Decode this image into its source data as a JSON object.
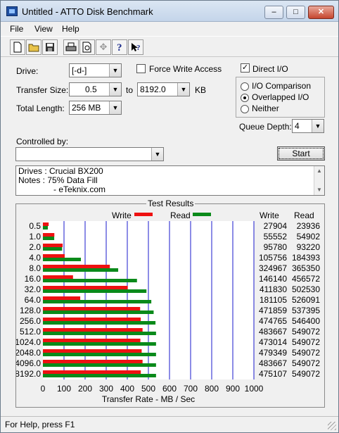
{
  "window": {
    "title": "Untitled - ATTO Disk Benchmark",
    "buttons": {
      "minimize": "–",
      "maximize": "□",
      "close": "✕"
    }
  },
  "menu": {
    "items": [
      "File",
      "View",
      "Help"
    ]
  },
  "toolbar": {
    "icons": [
      "new-file-icon",
      "open-folder-icon",
      "save-icon",
      "print-icon",
      "print-preview-icon",
      "move-icon",
      "help-icon",
      "context-help-icon"
    ]
  },
  "form": {
    "drive_label": "Drive:",
    "drive_value": "[-d-]",
    "force_write_label": "Force Write Access",
    "force_write_checked": false,
    "direct_io_label": "Direct I/O",
    "direct_io_checked": true,
    "transfer_size_label": "Transfer Size:",
    "transfer_from": "0.5",
    "to_label": "to",
    "transfer_to": "8192.0",
    "kb_label": "KB",
    "total_length_label": "Total Length:",
    "total_length_value": "256 MB",
    "io_options": [
      "I/O Comparison",
      "Overlapped I/O",
      "Neither"
    ],
    "io_selected": 1,
    "queue_depth_label": "Queue Depth:",
    "queue_depth_value": "4",
    "controlled_by_label": "Controlled by:",
    "controlled_by_value": "",
    "start_button": "Start",
    "notes_lines": [
      "Drives : Crucial BX200",
      "Notes :  75% Data Fill",
      "               - eTeknix.com"
    ]
  },
  "results": {
    "title": "Test Results",
    "legend_write": "Write",
    "legend_read": "Read",
    "col_write": "Write",
    "col_read": "Read",
    "colors": {
      "write": "#ee1111",
      "read": "#0a8a1a",
      "grid": "#1a1acc"
    }
  },
  "chart_data": {
    "type": "bar",
    "orientation": "horizontal",
    "categories": [
      "0.5",
      "1.0",
      "2.0",
      "4.0",
      "8.0",
      "16.0",
      "32.0",
      "64.0",
      "128.0",
      "256.0",
      "512.0",
      "1024.0",
      "2048.0",
      "4096.0",
      "8192.0"
    ],
    "series": [
      {
        "name": "Write",
        "values": [
          27904,
          55552,
          95780,
          105756,
          324967,
          146140,
          411830,
          181105,
          471859,
          474765,
          483667,
          473014,
          479349,
          483667,
          475107
        ]
      },
      {
        "name": "Read",
        "values": [
          23936,
          54902,
          93220,
          184393,
          365350,
          456572,
          502530,
          526091,
          537395,
          546400,
          549072,
          549072,
          549072,
          549072,
          549072
        ]
      }
    ],
    "xlabel": "Transfer Rate - MB / Sec",
    "xticks": [
      "0",
      "100",
      "200",
      "300",
      "400",
      "500",
      "600",
      "700",
      "800",
      "900",
      "1000"
    ],
    "xlim": [
      0,
      1000
    ]
  },
  "status": {
    "text": "For Help, press F1"
  }
}
